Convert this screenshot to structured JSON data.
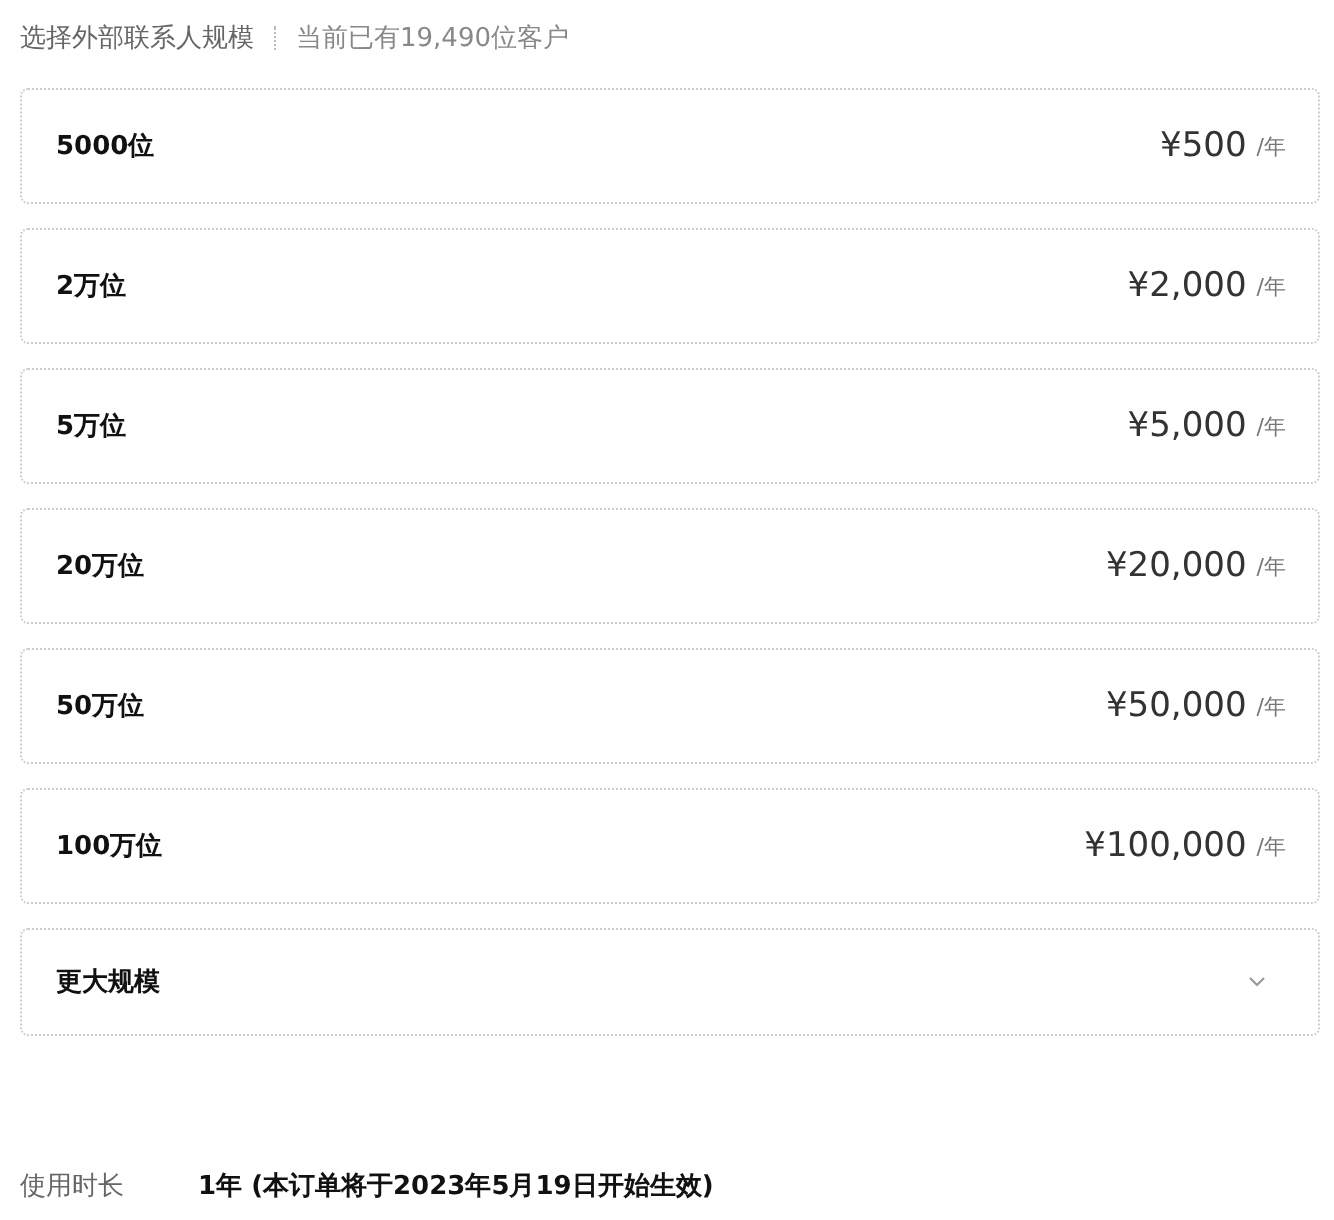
{
  "header": {
    "title": "选择外部联系人规模",
    "note": "当前已有19,490位客户"
  },
  "options": [
    {
      "kind": "price",
      "label": "5000位",
      "price": "¥500",
      "unit": "/年"
    },
    {
      "kind": "price",
      "label": "2万位",
      "price": "¥2,000",
      "unit": "/年"
    },
    {
      "kind": "price",
      "label": "5万位",
      "price": "¥5,000",
      "unit": "/年"
    },
    {
      "kind": "price",
      "label": "20万位",
      "price": "¥20,000",
      "unit": "/年"
    },
    {
      "kind": "price",
      "label": "50万位",
      "price": "¥50,000",
      "unit": "/年"
    },
    {
      "kind": "price",
      "label": "100万位",
      "price": "¥100,000",
      "unit": "/年"
    },
    {
      "kind": "expand",
      "label": "更大规模",
      "expanded": false
    }
  ],
  "duration": {
    "label": "使用时长",
    "value": "1年 (本订单将于2023年5月19日开始生效)"
  }
}
